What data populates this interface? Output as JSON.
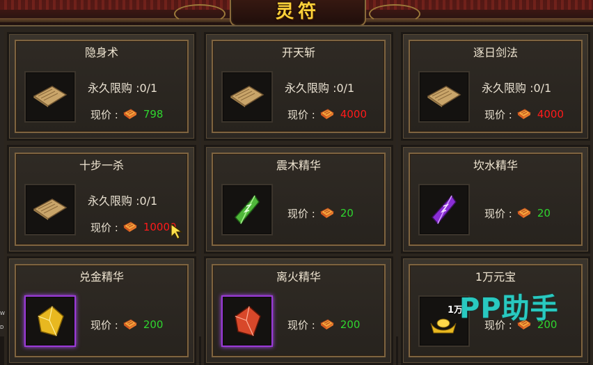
{
  "title": "灵符",
  "limit_prefix": "永久限购 :",
  "price_label": "现价 :",
  "items": [
    {
      "name": "隐身术",
      "limit": "0/1",
      "price": "798",
      "price_color": "#2fd52f",
      "icon": "scroll-icon"
    },
    {
      "name": "开天斩",
      "limit": "0/1",
      "price": "4000",
      "price_color": "#ff1a1a",
      "icon": "scroll-icon"
    },
    {
      "name": "逐日剑法",
      "limit": "0/1",
      "price": "4000",
      "price_color": "#ff1a1a",
      "icon": "scroll-icon"
    },
    {
      "name": "十步一杀",
      "limit": "0/1",
      "price": "10000",
      "price_color": "#ff1a1a",
      "icon": "scroll-icon"
    },
    {
      "name": "震木精华",
      "price": "20",
      "price_color": "#2fd52f",
      "icon": "green-gem-icon"
    },
    {
      "name": "坎水精华",
      "price": "20",
      "price_color": "#2fd52f",
      "icon": "purple-gem-icon"
    },
    {
      "name": "兑金精华",
      "price": "200",
      "price_color": "#2fd52f",
      "icon": "gold-gem-icon"
    },
    {
      "name": "离火精华",
      "price": "200",
      "price_color": "#2fd52f",
      "icon": "red-gem-icon"
    },
    {
      "name": "1万元宝",
      "price": "200",
      "price_color": "#2fd52f",
      "icon": "gold-ingot-icon",
      "icon_caption": "1万"
    }
  ],
  "watermark": "PP助手",
  "side_marks": [
    "W",
    "D"
  ]
}
